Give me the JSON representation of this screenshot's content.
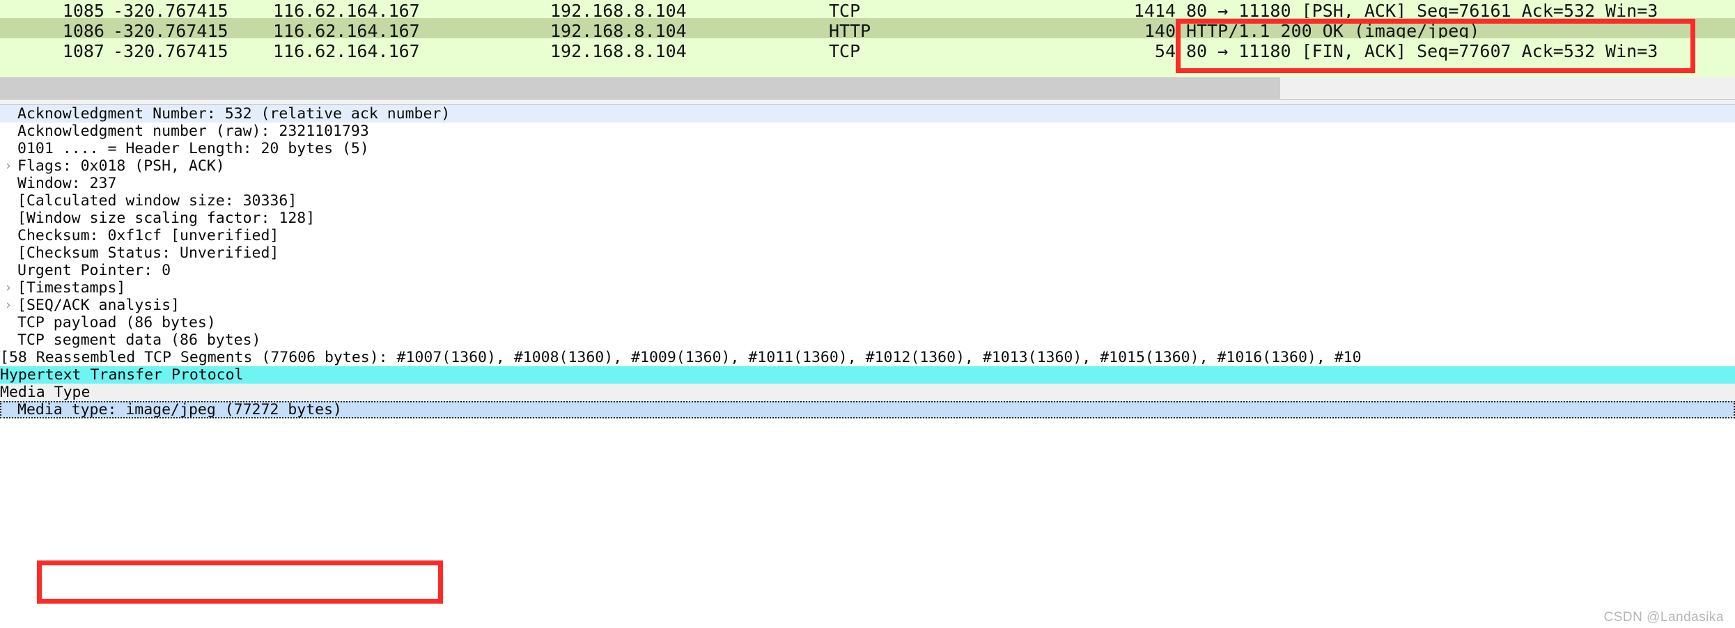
{
  "colors": {
    "packet_row_bg": "#e9ffd1",
    "packet_row_selected_bg": "#c5d9a5",
    "annotation_red": "#fc2b27",
    "detail_selected_blue": "#c5def9",
    "detail_protocol_cyan": "#6ff4f4",
    "detail_field_light_blue": "#e2eefb",
    "scrollbar_thumb": "#cdcdcd"
  },
  "packet_list": {
    "rows": [
      {
        "no": "1085",
        "time": "-320.767415",
        "source": "116.62.164.167",
        "destination": "192.168.8.104",
        "protocol": "TCP",
        "length": "1414",
        "info": "80 → 11180 [PSH, ACK] Seq=76161 Ack=532 Win=3",
        "selected": false
      },
      {
        "no": "1086",
        "time": "-320.767415",
        "source": "116.62.164.167",
        "destination": "192.168.8.104",
        "protocol": "HTTP",
        "length": "140",
        "info": "HTTP/1.1 200 OK  (image/jpeg)",
        "selected": true
      },
      {
        "no": "1087",
        "time": "-320.767415",
        "source": "116.62.164.167",
        "destination": "192.168.8.104",
        "protocol": "TCP",
        "length": "54",
        "info": "80 → 11180 [FIN, ACK] Seq=77607 Ack=532 Win=3",
        "selected": false
      }
    ]
  },
  "detail_pane": {
    "rows": [
      {
        "twisty": "",
        "text": "Acknowledgment Number: 532    (relative ack number)"
      },
      {
        "twisty": "",
        "text": "Acknowledgment number (raw): 2321101793"
      },
      {
        "twisty": "",
        "text": "0101 .... = Header Length: 20 bytes (5)"
      },
      {
        "twisty": "›",
        "text": "Flags: 0x018 (PSH, ACK)"
      },
      {
        "twisty": "",
        "text": "Window: 237"
      },
      {
        "twisty": "",
        "text": "[Calculated window size: 30336]"
      },
      {
        "twisty": "",
        "text": "[Window size scaling factor: 128]"
      },
      {
        "twisty": "",
        "text": "Checksum: 0xf1cf [unverified]"
      },
      {
        "twisty": "",
        "text": "[Checksum Status: Unverified]"
      },
      {
        "twisty": "",
        "text": "Urgent Pointer: 0"
      },
      {
        "twisty": "›",
        "text": "[Timestamps]"
      },
      {
        "twisty": "›",
        "text": "[SEQ/ACK analysis]"
      },
      {
        "twisty": "",
        "text": "TCP payload (86 bytes)"
      },
      {
        "twisty": "",
        "text": "TCP segment data (86 bytes)"
      }
    ],
    "reassembled_line": "[58 Reassembled TCP Segments (77606 bytes): #1007(1360), #1008(1360), #1009(1360), #1011(1360), #1012(1360), #1013(1360), #1015(1360), #1016(1360), #10",
    "http_protocol_line": "Hypertext Transfer Protocol",
    "media_type_header": "Media Type",
    "media_type_value": "Media type: image/jpeg (77272 bytes)"
  },
  "watermark": {
    "text": "CSDN @Landasika"
  }
}
